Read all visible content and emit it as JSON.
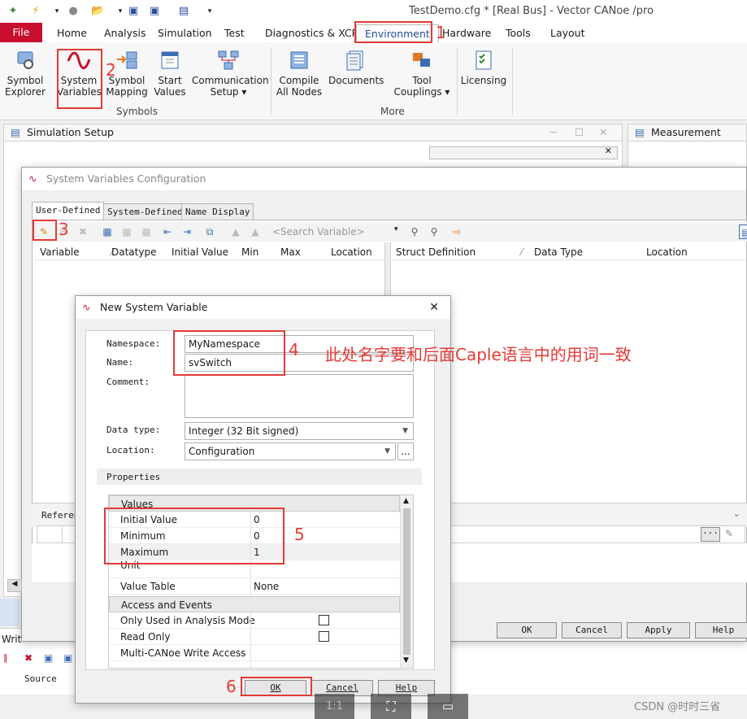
{
  "app": {
    "title": "TestDemo.cfg * [Real Bus] - Vector CANoe /pro"
  },
  "ribbon": {
    "tabs": [
      "File",
      "Home",
      "Analysis",
      "Simulation",
      "Test",
      "Diagnostics & XCP",
      "Environment",
      "Hardware",
      "Tools",
      "Layout"
    ],
    "buttons": {
      "symbol_explorer": [
        "Symbol",
        "Explorer"
      ],
      "system_variables": [
        "System",
        "Variables"
      ],
      "symbol_mapping": [
        "Symbol",
        "Mapping"
      ],
      "start_values": [
        "Start",
        "Values"
      ],
      "communication_setup": [
        "Communication",
        "Setup ▾"
      ],
      "compile_all_nodes": [
        "Compile",
        "All Nodes"
      ],
      "documents": [
        "Documents",
        ""
      ],
      "tool_couplings": [
        "Tool",
        "Couplings ▾"
      ],
      "licensing": [
        "Licensing",
        ""
      ]
    },
    "groups": {
      "symbols": "Symbols",
      "more": "More"
    }
  },
  "panes": {
    "simulation_setup": "Simulation Setup",
    "measurement_setup": "Measurement Setup",
    "refer_label": "Referen",
    "write_label": "Writ",
    "source_label": "Source"
  },
  "sysvar_dialog": {
    "title": "System Variables Configuration",
    "tabs": [
      "User-Defined",
      "System-Defined",
      "Name Display"
    ],
    "search_placeholder": "<Search Variable>",
    "left_columns": [
      "Variable",
      "Datatype",
      "Initial Value",
      "Min",
      "Max",
      "Location"
    ],
    "right_columns": [
      "Struct Definition",
      "Data Type",
      "Location"
    ],
    "buttons": {
      "ok": "OK",
      "cancel": "Cancel",
      "apply": "Apply",
      "help": "Help"
    }
  },
  "newvar_dialog": {
    "title": "New System Variable",
    "labels": {
      "namespace": "Namespace:",
      "name": "Name:",
      "comment": "Comment:",
      "datatype": "Data type:",
      "location": "Location:",
      "properties": "Properties"
    },
    "values": {
      "namespace": "MyNamespace",
      "name": "svSwitch",
      "datatype": "Integer (32 Bit signed)",
      "location": "Configuration",
      "location_more": "..."
    },
    "sections": {
      "values": "Values",
      "access": "Access and Events"
    },
    "rows": [
      {
        "k": "Initial Value",
        "v": "0"
      },
      {
        "k": "Minimum",
        "v": "0"
      },
      {
        "k": "Maximum",
        "v": "1"
      },
      {
        "k": "Unit",
        "v": ""
      },
      {
        "k": "Value Table",
        "v": "None"
      }
    ],
    "access_rows": [
      "Only Used in Analysis Mode",
      "Read Only",
      "Multi-CANoe Write Access"
    ],
    "buttons": {
      "ok": "OK",
      "cancel": "Cancel",
      "help": "Help"
    }
  },
  "annotations": {
    "n1": "1",
    "n2": "2",
    "n3": "3",
    "n4": "4",
    "n5": "5",
    "n6": "6",
    "note": "此处名字要和后面Caple语言中的用词一致"
  },
  "viewer": {
    "zoom": "1:1"
  },
  "watermark": "CSDN @时时三省",
  "colors": {
    "accent_red": "#e53935",
    "file_tab": "#c8102e",
    "link_blue": "#1f4e9e"
  }
}
